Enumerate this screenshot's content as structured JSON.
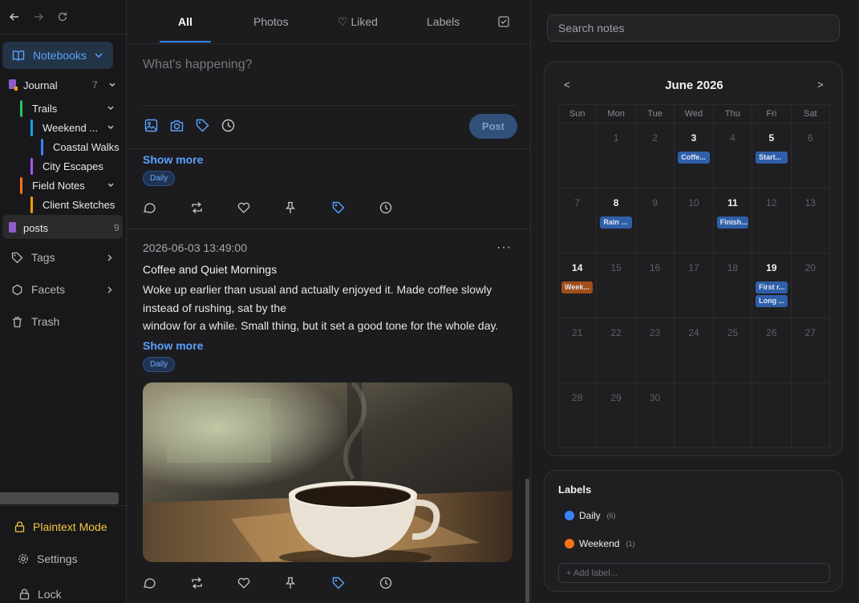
{
  "sidebar": {
    "notebooks_label": "Notebooks",
    "tree": [
      {
        "label": "Journal",
        "count": "7"
      },
      {
        "label": "Trails"
      },
      {
        "label": "Weekend ..."
      },
      {
        "label": "Coastal Walks"
      },
      {
        "label": "City Escapes"
      },
      {
        "label": "Field Notes"
      },
      {
        "label": "Client Sketches"
      }
    ],
    "posts": {
      "label": "posts",
      "count": "9"
    },
    "tags_label": "Tags",
    "facets_label": "Facets",
    "trash_label": "Trash",
    "plaintext_label": "Plaintext Mode",
    "settings_label": "Settings",
    "lock_label": "Lock"
  },
  "feed": {
    "tabs": [
      {
        "label": "All"
      },
      {
        "label": "Photos"
      },
      {
        "label": "♡ Liked"
      },
      {
        "label": "Labels"
      }
    ],
    "composer_placeholder": "What's happening?",
    "post_button": "Post",
    "show_more": "Show more",
    "prev_post_label": "Daily",
    "post": {
      "date": "2026-06-03 13:49:00",
      "title": "Coffee and Quiet Mornings",
      "body_1": "Woke up earlier than usual and actually enjoyed it. Made coffee slowly instead of rushing, sat by the",
      "body_2": "window for a while. Small thing, but it set a good tone for the whole day.",
      "label": "Daily",
      "more": "···"
    }
  },
  "search": {
    "placeholder": "Search notes"
  },
  "calendar": {
    "title": "June 2026",
    "prev": "<",
    "next": ">",
    "weekdays": [
      "Sun",
      "Mon",
      "Tue",
      "Wed",
      "Thu",
      "Fri",
      "Sat"
    ],
    "days": [
      {
        "d": "",
        "bold": false,
        "events": []
      },
      {
        "d": "1",
        "bold": false,
        "events": []
      },
      {
        "d": "2",
        "bold": false,
        "events": []
      },
      {
        "d": "3",
        "bold": true,
        "events": [
          {
            "t": "Coffe...",
            "c": "blue"
          }
        ]
      },
      {
        "d": "4",
        "bold": false,
        "events": []
      },
      {
        "d": "5",
        "bold": true,
        "events": [
          {
            "t": "Start...",
            "c": "blue"
          }
        ]
      },
      {
        "d": "6",
        "bold": false,
        "events": []
      },
      {
        "d": "7",
        "bold": false,
        "events": []
      },
      {
        "d": "8",
        "bold": true,
        "events": [
          {
            "t": "Rain ...",
            "c": "blue"
          }
        ]
      },
      {
        "d": "9",
        "bold": false,
        "events": []
      },
      {
        "d": "10",
        "bold": false,
        "events": []
      },
      {
        "d": "11",
        "bold": true,
        "events": [
          {
            "t": "Finish...",
            "c": "blue"
          }
        ]
      },
      {
        "d": "12",
        "bold": false,
        "events": []
      },
      {
        "d": "13",
        "bold": false,
        "events": []
      },
      {
        "d": "14",
        "bold": true,
        "events": [
          {
            "t": "Week...",
            "c": "orange"
          }
        ]
      },
      {
        "d": "15",
        "bold": false,
        "events": []
      },
      {
        "d": "16",
        "bold": false,
        "events": []
      },
      {
        "d": "17",
        "bold": false,
        "events": []
      },
      {
        "d": "18",
        "bold": false,
        "events": []
      },
      {
        "d": "19",
        "bold": true,
        "events": [
          {
            "t": "First r...",
            "c": "blue"
          },
          {
            "t": "Long ...",
            "c": "blue"
          }
        ]
      },
      {
        "d": "20",
        "bold": false,
        "events": []
      },
      {
        "d": "21",
        "bold": false,
        "events": []
      },
      {
        "d": "22",
        "bold": false,
        "events": []
      },
      {
        "d": "23",
        "bold": false,
        "events": []
      },
      {
        "d": "24",
        "bold": false,
        "events": []
      },
      {
        "d": "25",
        "bold": false,
        "events": []
      },
      {
        "d": "26",
        "bold": false,
        "events": []
      },
      {
        "d": "27",
        "bold": false,
        "events": []
      },
      {
        "d": "28",
        "bold": false,
        "events": []
      },
      {
        "d": "29",
        "bold": false,
        "events": []
      },
      {
        "d": "30",
        "bold": false,
        "events": []
      },
      {
        "d": "",
        "bold": false,
        "events": []
      },
      {
        "d": "",
        "bold": false,
        "events": []
      },
      {
        "d": "",
        "bold": false,
        "events": []
      },
      {
        "d": "",
        "bold": false,
        "events": []
      }
    ]
  },
  "labels_panel": {
    "title": "Labels",
    "items": [
      {
        "name": "Daily",
        "count": "(6)",
        "color": "#3b82f6"
      },
      {
        "name": "Weekend",
        "count": "(1)",
        "color": "#f97316"
      }
    ],
    "add_placeholder": "+ Add label..."
  },
  "colors": {
    "accent": "#3b82f6",
    "plaintext": "#f5c542"
  }
}
